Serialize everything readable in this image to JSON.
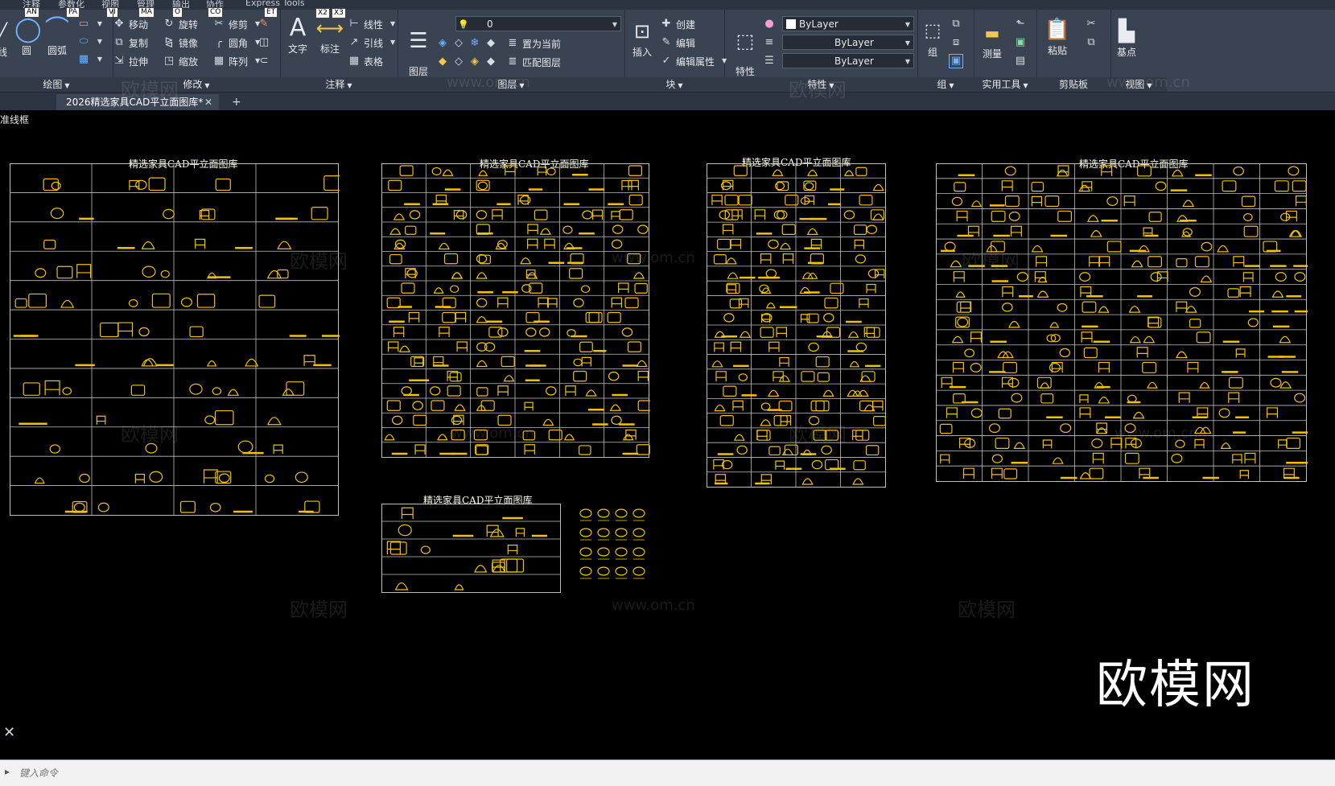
{
  "menubar": {
    "items": [
      "注释",
      "参数化",
      "视图",
      "管理",
      "输出",
      "协作",
      "Express Tools"
    ],
    "hint_keys": [
      "AN",
      "PA",
      "VI",
      "MA",
      "O",
      "CO",
      "ET"
    ]
  },
  "ribbon": {
    "draw": {
      "label": "绘图",
      "items": {
        "line": "线",
        "circle": "圆",
        "arc": "圆弧"
      }
    },
    "modify": {
      "label": "修改",
      "items": {
        "move": "移动",
        "rotate": "旋转",
        "trim": "修剪",
        "copy": "复制",
        "mirror": "镜像",
        "fillet": "圆角",
        "stretch": "拉伸",
        "scale": "缩放",
        "array": "阵列"
      }
    },
    "annotation": {
      "label": "注释",
      "items": {
        "text": "文字",
        "dimension": "标注",
        "linear": "线性",
        "leader": "引线",
        "table": "表格"
      },
      "hint_keys": [
        "X2",
        "X3"
      ]
    },
    "layers": {
      "label": "图层",
      "layer_props": "图层\n特性",
      "current_layer": "0",
      "set_current": "置为当前",
      "match_layer": "匹配图层"
    },
    "block": {
      "label": "块",
      "insert": "插入",
      "create": "创建",
      "edit": "编辑",
      "edit_attr": "编辑属性"
    },
    "properties": {
      "label": "特性",
      "match": "特性\n匹配",
      "color": "ByLayer",
      "linetype": "ByLayer",
      "lineweight": "ByLayer"
    },
    "groups": {
      "label": "组",
      "group": "组"
    },
    "utilities": {
      "label": "实用工具",
      "measure": "测量"
    },
    "clipboard": {
      "label": "剪贴板",
      "paste": "粘贴"
    },
    "view": {
      "label": "视图",
      "base": "基点"
    }
  },
  "tabs": {
    "active": "2026精选家具CAD平立面图库*",
    "add": "+"
  },
  "canvas": {
    "viewport_label": "准线框",
    "sheets": [
      {
        "title": "精选家具CAD平立面图库"
      },
      {
        "title": "精选家具CAD平立面图库"
      },
      {
        "title": "精选家具CAD平立面图库"
      },
      {
        "title": "精选家具CAD平立面图库"
      },
      {
        "title": "精选家具CAD平立面图库"
      }
    ],
    "watermarks": [
      "欧模网",
      "www.om.cn"
    ],
    "brand": "欧模网"
  },
  "command_line": {
    "placeholder": "键入命令"
  },
  "colors": {
    "ribbon_bg": "#3a4352",
    "canvas_bg": "#000000",
    "grid_line": "#bfbfbf",
    "furniture": "#f2c200",
    "title_text": "#fffde6"
  }
}
